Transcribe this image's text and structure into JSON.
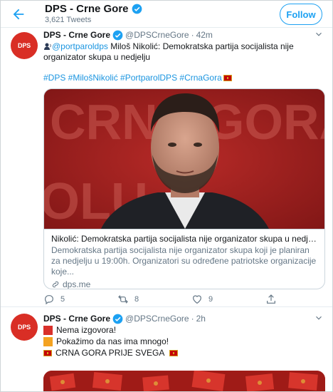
{
  "header": {
    "title": "DPS - Crne Gore",
    "tweet_count": "3,621 Tweets",
    "follow_label": "Follow"
  },
  "tweets": [
    {
      "name": "DPS - Crne Gore",
      "handle": "@DPSCrneGore",
      "dot": "·",
      "time": "42m",
      "avatar_text": "DPS",
      "mention": "@portparoldps",
      "text": " Miloš Nikolić: Demokratska partija socijalista nije organizator skupa u nedjelju",
      "hashtags": "#DPS #MilošNikolić #PortparolDPS #CrnaGora",
      "card": {
        "image_overlay_text": "CRNA GORA",
        "image_overlay_text2": "OLU",
        "title": "Nikolić: Demokratska partija socijalista nije organizator skupa u nedjelju",
        "description": "Demokratska partija socijalista nije organizator skupa koji je planiran za nedjelju u 19:00h. Organizatori su određene patriotske organizacije koje...",
        "domain": "dps.me"
      },
      "replies": "5",
      "retweets": "8",
      "likes": "9"
    },
    {
      "name": "DPS - Crne Gore",
      "handle": "@DPSCrneGore",
      "dot": "·",
      "time": "2h",
      "avatar_text": "DPS",
      "lines": [
        {
          "text": "Nema izgovora!",
          "icon": "red-square-icon"
        },
        {
          "text": "Pokažimo da nas ima mnogo!",
          "icon": "orange-square-icon"
        },
        {
          "text": "CRNA GORA PRIJE SVEGA",
          "icon": "montenegro-flag-icon"
        }
      ]
    }
  ],
  "colors": {
    "accent": "#1da1f2",
    "brand_red": "#d92e25",
    "muted": "#657786"
  }
}
